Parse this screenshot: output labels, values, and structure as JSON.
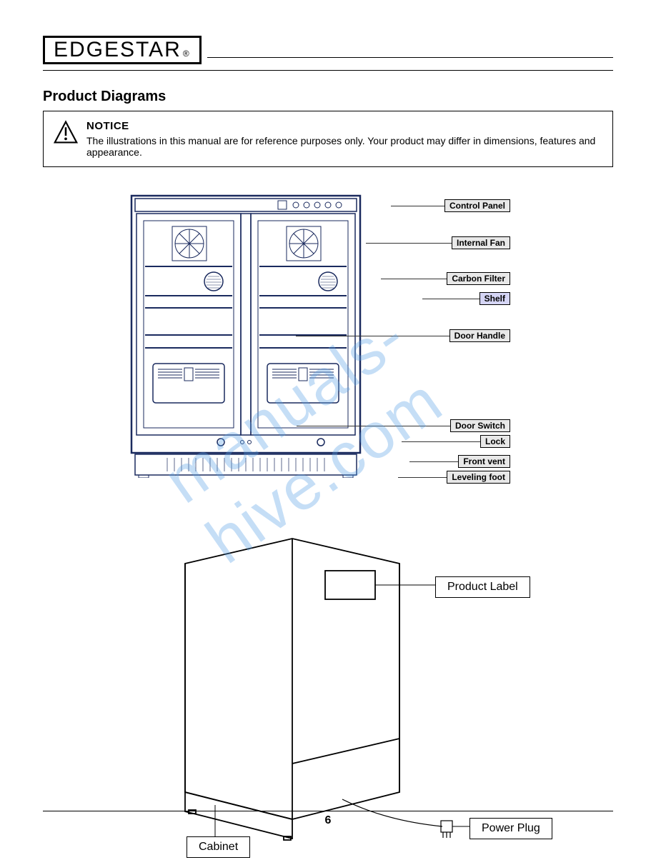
{
  "brand": "EDGESTAR",
  "reg": "®",
  "section_title": "Product Diagrams",
  "notice": {
    "title": "NOTICE",
    "body": "The illustrations in this manual are for reference purposes only. Your product may differ in dimensions, features and appearance."
  },
  "callouts_front": [
    "Control Panel",
    "Internal Fan",
    "Carbon Filter",
    "Shelf",
    "Door Handle",
    "Door Switch",
    "Lock",
    "Front vent",
    "Leveling foot"
  ],
  "back_labels": {
    "product_label": "Product Label",
    "cabinet": "Cabinet",
    "power_plug": "Power Plug"
  },
  "watermark": "manuals-hive.com",
  "page_number": "6"
}
